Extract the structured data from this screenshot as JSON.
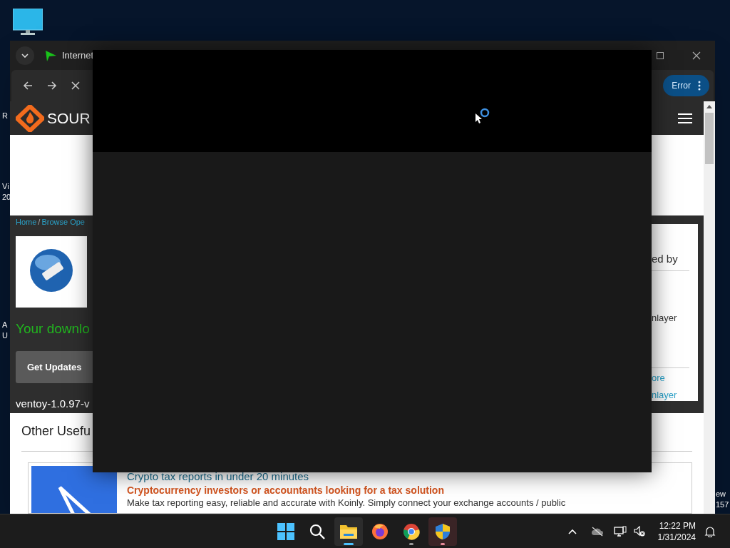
{
  "desktop": {
    "left_labels": [
      {
        "lines": [
          "R"
        ]
      },
      {
        "lines": [
          "Vi",
          "20"
        ]
      },
      {
        "lines": [
          "A",
          "U"
        ]
      }
    ],
    "right_labels": [
      {
        "lines": [
          "ew",
          "157"
        ]
      }
    ]
  },
  "browser": {
    "title": "Internet",
    "status_button": "Error",
    "site_logo": "SOUR",
    "breadcrumb": {
      "items": [
        "Home",
        "Browse Ope"
      ],
      "separator": "/"
    },
    "download_heading": "Your downlo",
    "update_button": "Get Updates",
    "file_name": "ventoy-1.0.97-v",
    "sidebar_card": [
      {
        "kind": "heading",
        "text": "ed by"
      },
      {
        "kind": "text",
        "text": "nlayer"
      },
      {
        "kind": "link",
        "text": "ore"
      },
      {
        "kind": "link",
        "text": "nlayer"
      }
    ],
    "section_title": "Other Usefu",
    "ad": {
      "title": "Crypto tax reports in under 20 minutes",
      "subtitle": "Cryptocurrency investors or accountants looking for a tax solution",
      "body": "Make tax reporting easy, reliable and accurate with Koinly. Simply connect your exchange accounts / public"
    }
  },
  "taskbar": {
    "apps": [
      {
        "kind": "start",
        "selected": false,
        "running": false
      },
      {
        "kind": "search",
        "selected": false,
        "running": false
      },
      {
        "kind": "files",
        "selected": true,
        "running": true
      },
      {
        "kind": "firefox",
        "selected": false,
        "running": false
      },
      {
        "kind": "chrome",
        "selected": false,
        "running": true
      },
      {
        "kind": "shield",
        "selected": true,
        "running": true
      }
    ],
    "time": "12:22 PM",
    "date": "1/31/2024"
  }
}
